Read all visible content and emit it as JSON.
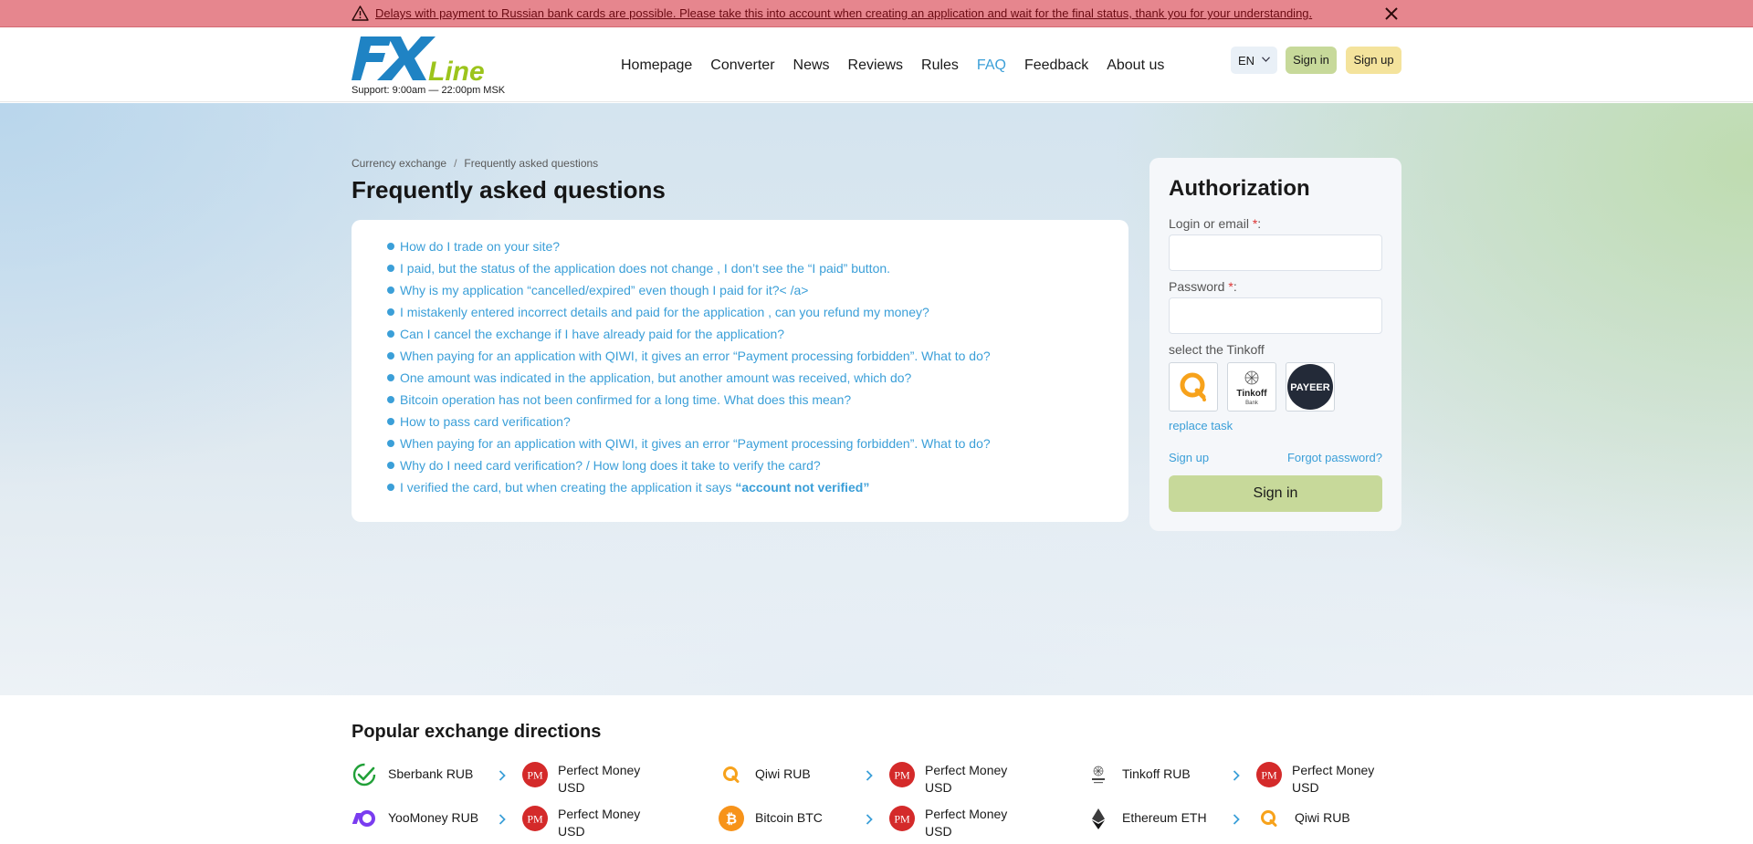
{
  "alert": {
    "message": "Delays with payment to Russian bank cards are possible. Please take this into account when creating an application and wait for the final status, thank you for your understanding."
  },
  "header": {
    "logo_text": "FX Line",
    "support": "Support: 9:00am — 22:00pm MSK",
    "nav": [
      "Homepage",
      "Converter",
      "News",
      "Reviews",
      "Rules",
      "FAQ",
      "Feedback",
      "About us"
    ],
    "active_nav": "FAQ",
    "lang": "EN",
    "signin": "Sign in",
    "signup": "Sign up"
  },
  "breadcrumb": [
    "Currency exchange",
    "Frequently asked questions"
  ],
  "page_title": "Frequently asked questions",
  "faq": [
    "How do I trade on your site?",
    "I paid, but the status of the application does not change , I don’t see the “I paid” button.",
    "Why is my application “cancelled/expired” even though I paid for it?< /a>",
    "I mistakenly entered incorrect details and paid for the application , can you refund my money?",
    "Can I cancel the exchange if I have already paid for the application?",
    "When paying for an application with QIWI, it gives an error “Payment processing forbidden”. What to do?",
    "One amount was indicated in the application, but another amount was received, which do?",
    "Bitcoin operation has not been confirmed for a long time. What does this mean?",
    "How to pass card verification?",
    "When paying for an application with QIWI, it gives an error “Payment processing forbidden”. What to do?",
    "Why do I need card verification? / How long does it take to verify the card?"
  ],
  "faq_last": {
    "prefix": "I verified the card, but when creating the application it says ",
    "bold": "“account not verified”"
  },
  "auth": {
    "title": "Authorization",
    "login_label": "Login or email",
    "password_label": "Password",
    "required_mark": "*",
    "colon": ":",
    "captcha_prompt": "select the Tinkoff",
    "captcha_options": [
      "qiwi-icon",
      "tinkoff-icon",
      "payeer-icon"
    ],
    "tinkoff_logo_text": "Tinkoff",
    "tinkoff_logo_sub": "Bank",
    "payeer_logo_text": "PAYEER",
    "replace_task": "replace task",
    "signup_link": "Sign up",
    "forgot_link": "Forgot password?",
    "submit": "Sign in"
  },
  "popular": {
    "title": "Popular exchange directions",
    "pm_icon_text": "PM",
    "pairs": [
      {
        "from": "Sberbank RUB",
        "from_icon": "sberbank-icon",
        "to": [
          "Perfect Money",
          "USD"
        ],
        "to_icon": "perfect-money-icon"
      },
      {
        "from": "Qiwi RUB",
        "from_icon": "qiwi-icon",
        "to": [
          "Perfect Money",
          "USD"
        ],
        "to_icon": "perfect-money-icon"
      },
      {
        "from": "Tinkoff RUB",
        "from_icon": "tinkoff-icon",
        "to": [
          "Perfect Money",
          "USD"
        ],
        "to_icon": "perfect-money-icon"
      },
      {
        "from": "YooMoney RUB",
        "from_icon": "yoomoney-icon",
        "to": [
          "Perfect Money",
          "USD"
        ],
        "to_icon": "perfect-money-icon"
      },
      {
        "from": "Bitcoin BTC",
        "from_icon": "bitcoin-icon",
        "to": [
          "Perfect Money",
          "USD"
        ],
        "to_icon": "perfect-money-icon"
      },
      {
        "from": "Ethereum ETH",
        "from_icon": "ethereum-icon",
        "to": [
          "Qiwi RUB"
        ],
        "to_icon": "qiwi-icon"
      }
    ]
  },
  "colors": {
    "alert_bg": "#e6868e",
    "link": "#3b9fd8",
    "signin_bg": "#c7d99a",
    "signup_bg": "#f4e39c",
    "logo_blue": "#1f83c4",
    "logo_green": "#9cc41c"
  }
}
